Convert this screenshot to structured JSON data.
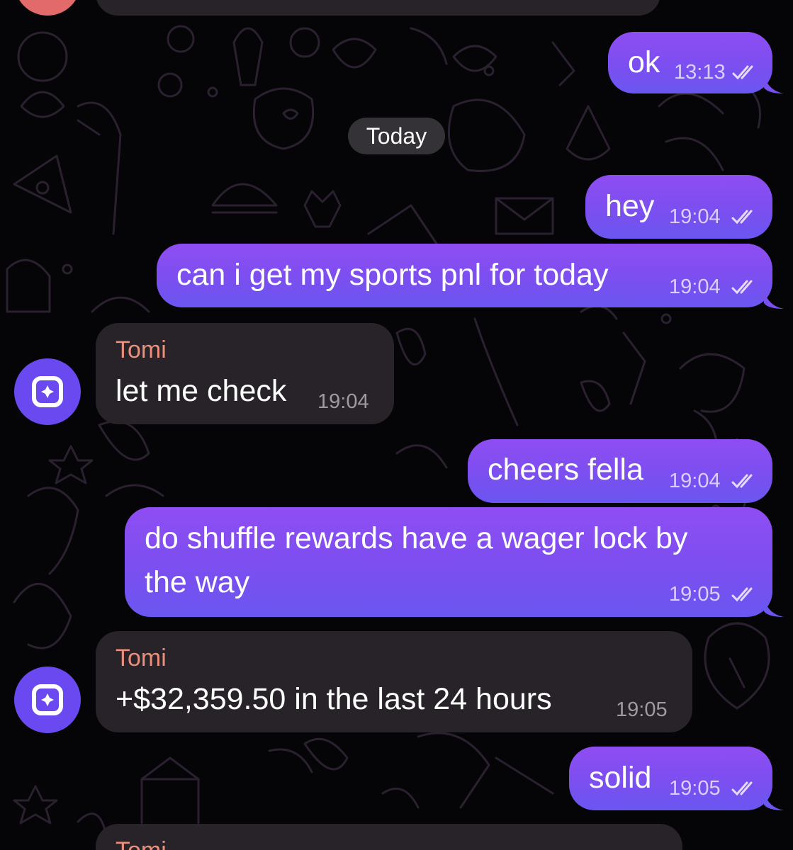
{
  "date_separator": "Today",
  "sender_name": "Tomi",
  "messages": [
    {
      "direction": "outgoing",
      "text": "ok",
      "time": "13:13",
      "status": "read"
    },
    {
      "direction": "outgoing",
      "text": "hey",
      "time": "19:04",
      "status": "read"
    },
    {
      "direction": "outgoing",
      "text": "can i get my sports pnl for today",
      "time": "19:04",
      "status": "read"
    },
    {
      "direction": "incoming",
      "sender": "Tomi",
      "text": "let me check",
      "time": "19:04"
    },
    {
      "direction": "outgoing",
      "text": "cheers fella",
      "time": "19:04",
      "status": "read"
    },
    {
      "direction": "outgoing",
      "text_line1": "do shuffle rewards have a wager lock by",
      "text_line2": "the way",
      "time": "19:05",
      "status": "read"
    },
    {
      "direction": "incoming",
      "sender": "Tomi",
      "text": "+$32,359.50 in the last 24 hours",
      "time": "19:05"
    },
    {
      "direction": "outgoing",
      "text": "solid",
      "time": "19:05",
      "status": "read"
    },
    {
      "direction": "incoming",
      "sender": "Tomi",
      "text": "",
      "time": ""
    }
  ],
  "colors": {
    "outgoing_bubble": "#8a4ef2",
    "incoming_bubble": "#272329",
    "sender_name": "#e8907c",
    "avatar": "#6b49f0",
    "background": "#050407"
  },
  "icons": {
    "avatar": "shuffle-logo-icon",
    "read_receipt": "double-check-icon"
  }
}
